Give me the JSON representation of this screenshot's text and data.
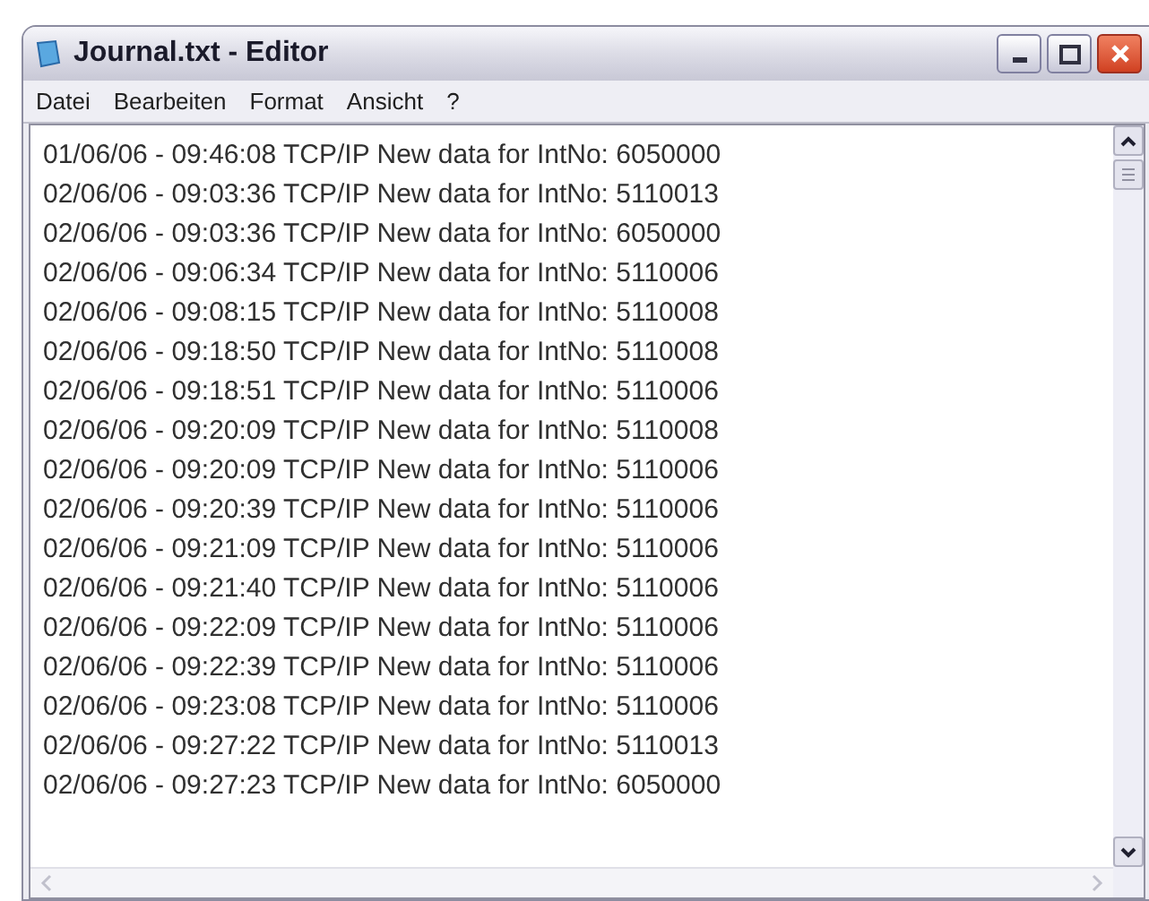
{
  "window": {
    "title": "Journal.txt - Editor"
  },
  "menu": [
    "Datei",
    "Bearbeiten",
    "Format",
    "Ansicht",
    "?"
  ],
  "lines": [
    "01/06/06 - 09:46:08 TCP/IP New data for IntNo: 6050000",
    "02/06/06 - 09:03:36 TCP/IP New data for IntNo: 5110013",
    "02/06/06 - 09:03:36 TCP/IP New data for IntNo: 6050000",
    "02/06/06 - 09:06:34 TCP/IP New data for IntNo: 5110006",
    "02/06/06 - 09:08:15 TCP/IP New data for IntNo: 5110008",
    "02/06/06 - 09:18:50 TCP/IP New data for IntNo: 5110008",
    "02/06/06 - 09:18:51 TCP/IP New data for IntNo: 5110006",
    "02/06/06 - 09:20:09 TCP/IP New data for IntNo: 5110008",
    "02/06/06 - 09:20:09 TCP/IP New data for IntNo: 5110006",
    "02/06/06 - 09:20:39 TCP/IP New data for IntNo: 5110006",
    "02/06/06 - 09:21:09 TCP/IP New data for IntNo: 5110006",
    "02/06/06 - 09:21:40 TCP/IP New data for IntNo: 5110006",
    "02/06/06 - 09:22:09 TCP/IP New data for IntNo: 5110006",
    "02/06/06 - 09:22:39 TCP/IP New data for IntNo: 5110006",
    "02/06/06 - 09:23:08 TCP/IP New data for IntNo: 5110006",
    "02/06/06 - 09:27:22 TCP/IP New data for IntNo: 5110013",
    "02/06/06 - 09:27:23 TCP/IP New data for IntNo: 6050000"
  ]
}
